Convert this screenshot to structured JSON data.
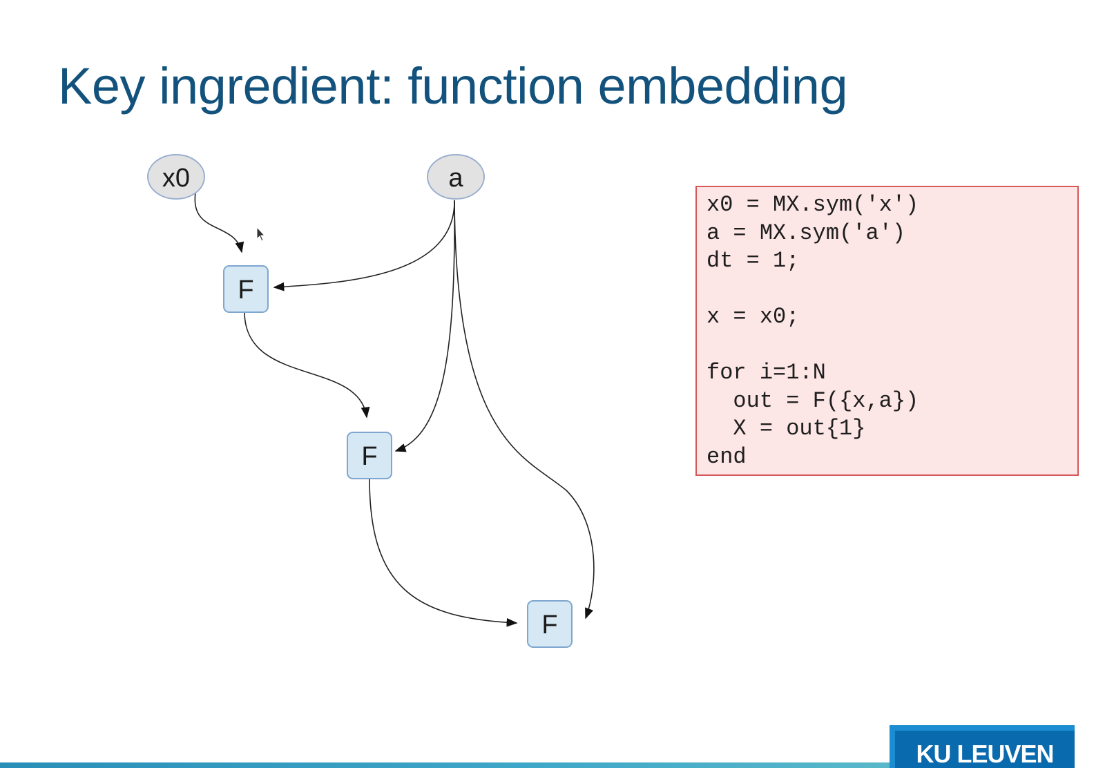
{
  "slide": {
    "title": "Key ingredient: function embedding"
  },
  "graph": {
    "nodes": [
      {
        "id": "x0",
        "label": "x0",
        "shape": "ellipse"
      },
      {
        "id": "a",
        "label": "a",
        "shape": "ellipse"
      },
      {
        "id": "F1",
        "label": "F",
        "shape": "box"
      },
      {
        "id": "F2",
        "label": "F",
        "shape": "box"
      },
      {
        "id": "F3",
        "label": "F",
        "shape": "box"
      }
    ],
    "edges": [
      {
        "from": "x0",
        "to": "F1"
      },
      {
        "from": "a",
        "to": "F1"
      },
      {
        "from": "F1",
        "to": "F2"
      },
      {
        "from": "a",
        "to": "F2"
      },
      {
        "from": "F2",
        "to": "F3"
      },
      {
        "from": "a",
        "to": "F3"
      }
    ]
  },
  "code": {
    "lines": [
      "x0 = MX.sym('x')",
      "a = MX.sym('a')",
      "dt = 1;",
      "",
      "x = x0;",
      "",
      "for i=1:N",
      "  out = F({x,a})",
      "  X = out{1}",
      "end"
    ]
  },
  "logo": {
    "text": "KU LEUVEN"
  },
  "colors": {
    "title": "#12527c",
    "ellipse_fill": "#e2e2e2",
    "ellipse_stroke": "#9aaed0",
    "box_fill": "#d5e8f4",
    "box_stroke": "#7fa6cf",
    "code_bg": "#fde6e6",
    "code_border": "#d55757",
    "logo_bg": "#0a6aae"
  }
}
